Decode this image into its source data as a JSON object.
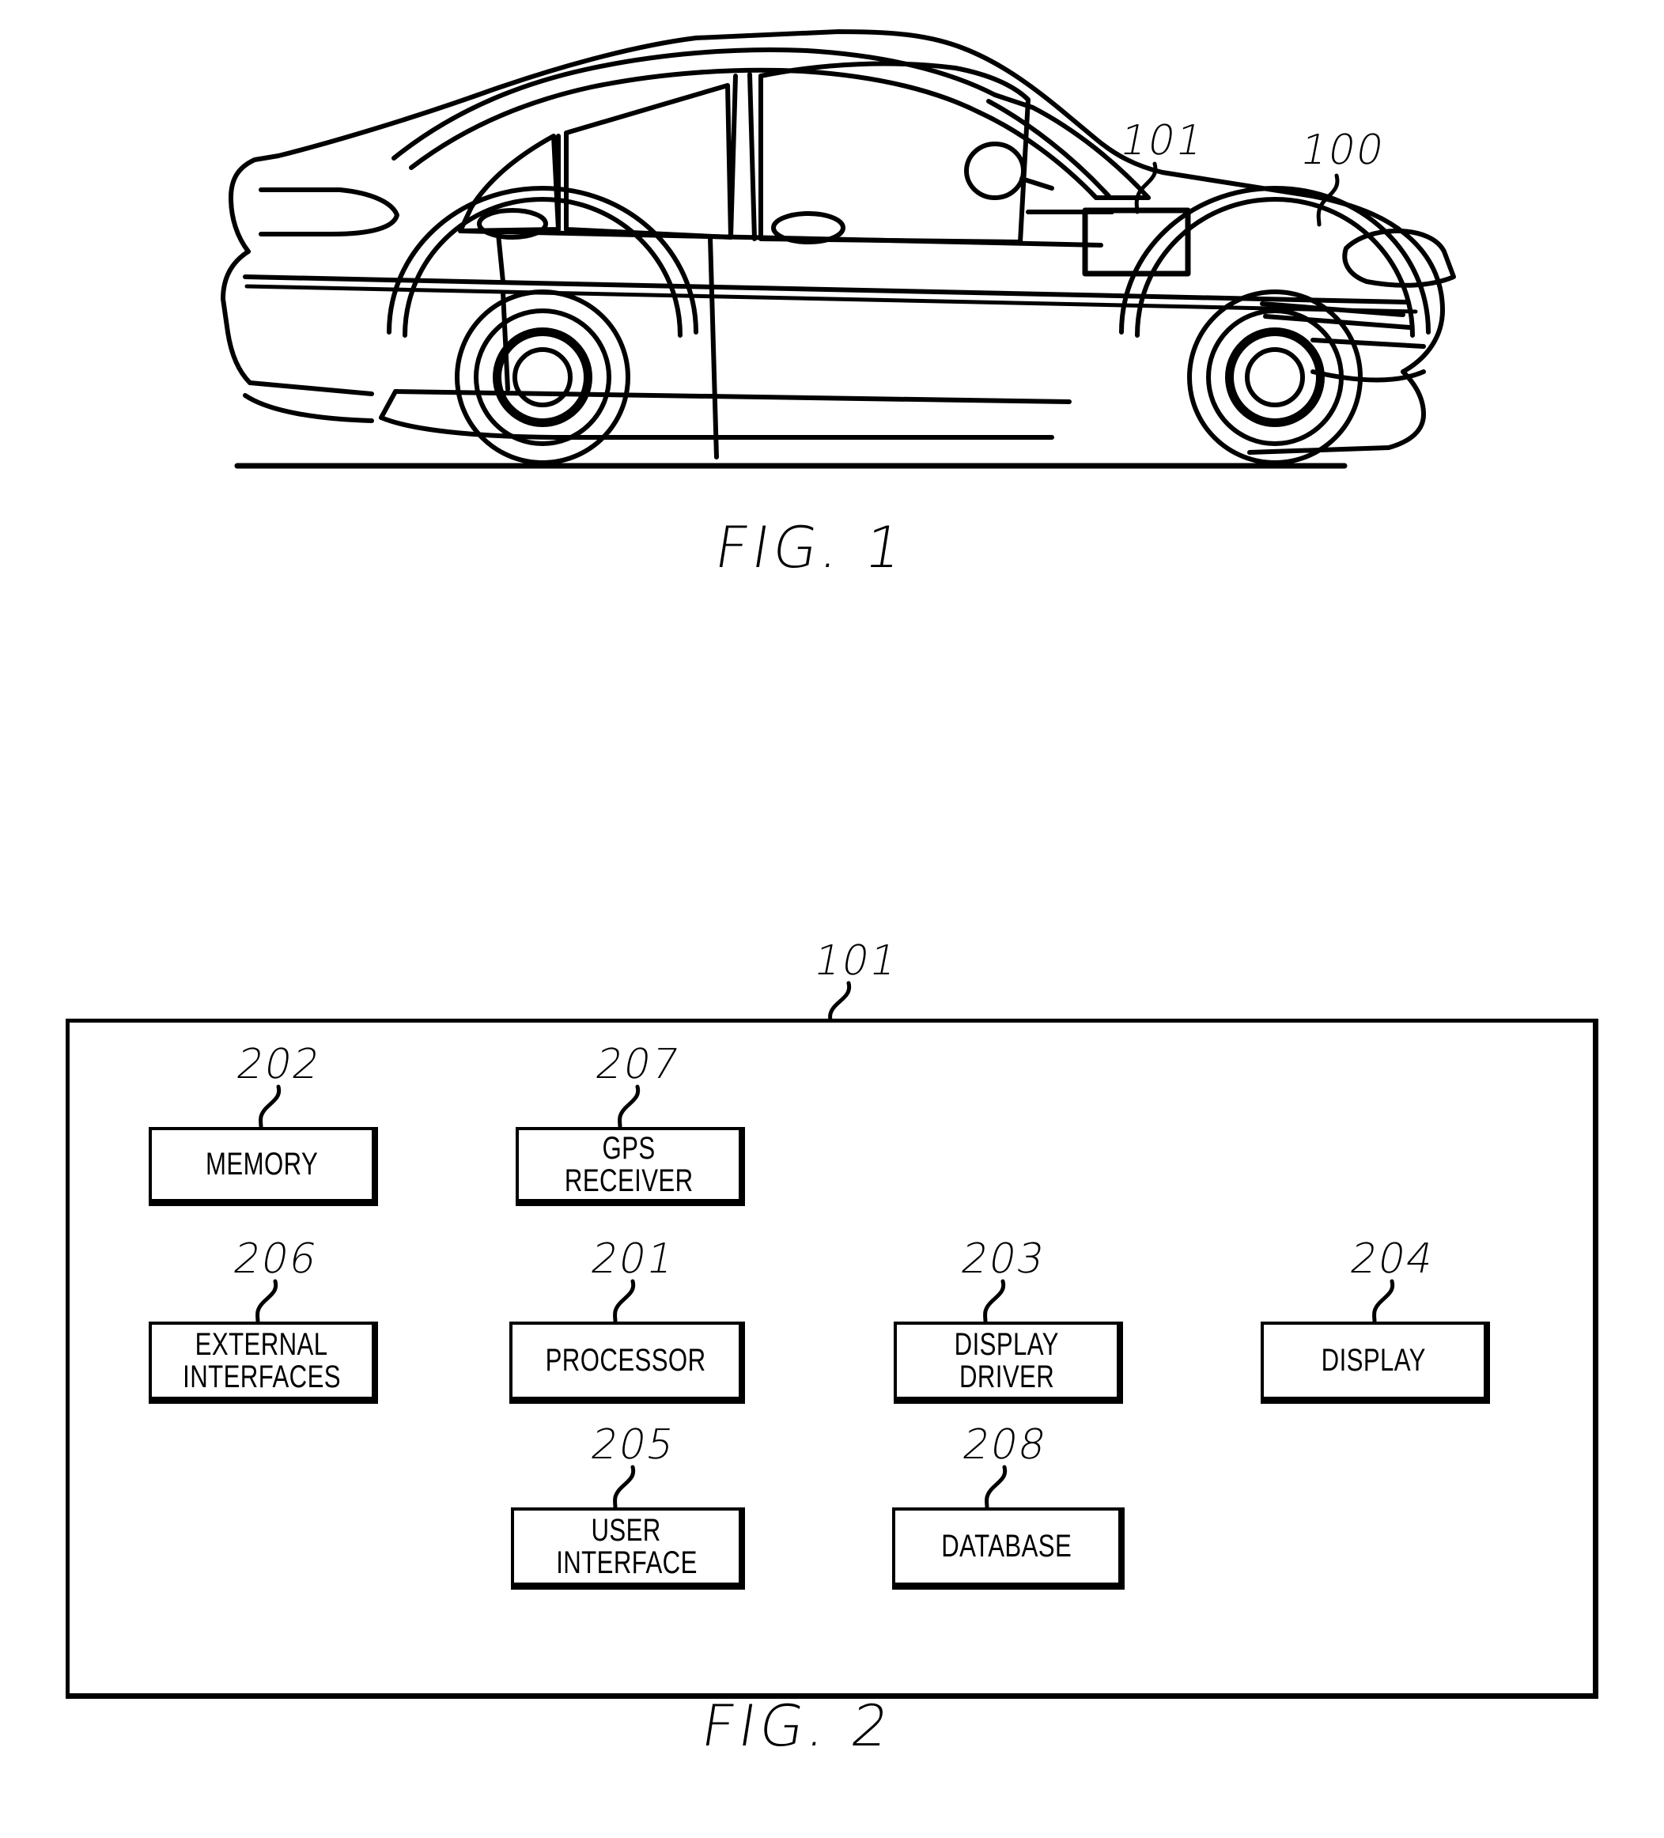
{
  "document": {
    "type": "patent-drawing-sheet",
    "background_color": "#ffffff",
    "line_color": "#000000"
  },
  "figures": [
    {
      "id": "fig1",
      "caption": "FIG. 1",
      "subject": "vehicle-side-elevation",
      "reference_numerals": [
        {
          "label": "101",
          "points_to": "in-vehicle-device-box"
        },
        {
          "label": "100",
          "points_to": "vehicle-body"
        }
      ]
    },
    {
      "id": "fig2",
      "caption": "FIG. 2",
      "subject": "block-diagram",
      "enclosure": {
        "label": "101",
        "name": "navigation-system-enclosure"
      },
      "blocks": [
        {
          "ref": "202",
          "lines": [
            "MEMORY"
          ],
          "name": "memory"
        },
        {
          "ref": "207",
          "lines": [
            "GPS",
            "RECEIVER"
          ],
          "name": "gps-receiver"
        },
        {
          "ref": "206",
          "lines": [
            "EXTERNAL",
            "INTERFACES"
          ],
          "name": "external-interfaces"
        },
        {
          "ref": "201",
          "lines": [
            "PROCESSOR"
          ],
          "name": "processor"
        },
        {
          "ref": "203",
          "lines": [
            "DISPLAY",
            "DRIVER"
          ],
          "name": "display-driver"
        },
        {
          "ref": "204",
          "lines": [
            "DISPLAY"
          ],
          "name": "display"
        },
        {
          "ref": "205",
          "lines": [
            "USER",
            "INTERFACE"
          ],
          "name": "user-interface"
        },
        {
          "ref": "208",
          "lines": [
            "DATABASE"
          ],
          "name": "database"
        }
      ]
    }
  ]
}
